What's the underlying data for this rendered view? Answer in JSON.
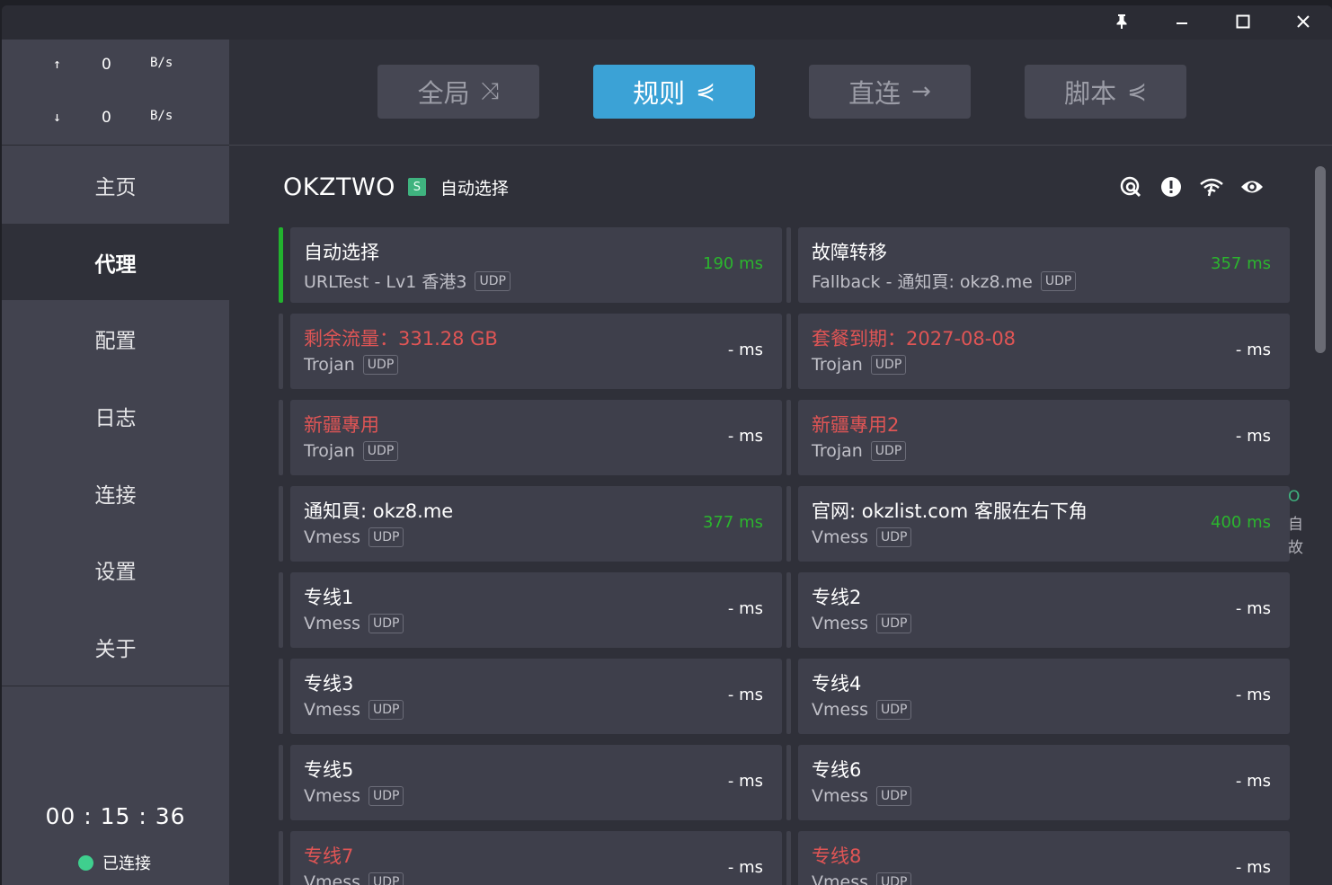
{
  "window": {
    "buttons": [
      "pin-icon",
      "minimize-icon",
      "maximize-icon",
      "close-icon"
    ]
  },
  "traffic": {
    "up_arrow": "↑",
    "up_value": "0",
    "up_unit": "B/s",
    "down_arrow": "↓",
    "down_value": "0",
    "down_unit": "B/s"
  },
  "sidebar": {
    "items": [
      {
        "label": "主页"
      },
      {
        "label": "代理"
      },
      {
        "label": "配置"
      },
      {
        "label": "日志"
      },
      {
        "label": "连接"
      },
      {
        "label": "设置"
      },
      {
        "label": "关于"
      }
    ],
    "active_index": 1,
    "timer": "00 : 15 : 36",
    "status": "已连接",
    "status_color": "#3fcf8e"
  },
  "modes": [
    {
      "label": "全局",
      "glyph": "⤨",
      "active": false
    },
    {
      "label": "规则",
      "glyph": "⋞",
      "active": true
    },
    {
      "label": "直连",
      "glyph": "→",
      "active": false
    },
    {
      "label": "脚本",
      "glyph": "⋞",
      "active": false
    }
  ],
  "group": {
    "name": "OKZTWO",
    "badge": "S",
    "selected": "自动选择",
    "icons": [
      "speed-test-icon",
      "alert-icon",
      "wifi-icon",
      "eye-icon"
    ]
  },
  "proxies": [
    {
      "name": "自动选择",
      "type": "URLTest - Lv1 香港3",
      "udp": "UDP",
      "delay": "190 ms",
      "delay_color": "green",
      "name_red": false,
      "selected": true
    },
    {
      "name": "故障转移",
      "type": "Fallback - 通知頁: okz8.me",
      "udp": "UDP",
      "delay": "357 ms",
      "delay_color": "green",
      "name_red": false,
      "selected": false
    },
    {
      "name": "剩余流量：331.28 GB",
      "type": "Trojan",
      "udp": "UDP",
      "delay": "- ms",
      "delay_color": "white",
      "name_red": true,
      "selected": false
    },
    {
      "name": "套餐到期：2027-08-08",
      "type": "Trojan",
      "udp": "UDP",
      "delay": "- ms",
      "delay_color": "white",
      "name_red": true,
      "selected": false
    },
    {
      "name": "新疆專用",
      "type": "Trojan",
      "udp": "UDP",
      "delay": "- ms",
      "delay_color": "white",
      "name_red": true,
      "selected": false
    },
    {
      "name": "新疆專用2",
      "type": "Trojan",
      "udp": "UDP",
      "delay": "- ms",
      "delay_color": "white",
      "name_red": true,
      "selected": false
    },
    {
      "name": "通知頁: okz8.me",
      "type": "Vmess",
      "udp": "UDP",
      "delay": "377 ms",
      "delay_color": "green",
      "name_red": false,
      "selected": false
    },
    {
      "name": "官网: okzlist.com 客服在右下角",
      "type": "Vmess",
      "udp": "UDP",
      "delay": "400 ms",
      "delay_color": "green",
      "name_red": false,
      "selected": false
    },
    {
      "name": "专线1",
      "type": "Vmess",
      "udp": "UDP",
      "delay": "- ms",
      "delay_color": "white",
      "name_red": false,
      "selected": false
    },
    {
      "name": "专线2",
      "type": "Vmess",
      "udp": "UDP",
      "delay": "- ms",
      "delay_color": "white",
      "name_red": false,
      "selected": false
    },
    {
      "name": "专线3",
      "type": "Vmess",
      "udp": "UDP",
      "delay": "- ms",
      "delay_color": "white",
      "name_red": false,
      "selected": false
    },
    {
      "name": "专线4",
      "type": "Vmess",
      "udp": "UDP",
      "delay": "- ms",
      "delay_color": "white",
      "name_red": false,
      "selected": false
    },
    {
      "name": "专线5",
      "type": "Vmess",
      "udp": "UDP",
      "delay": "- ms",
      "delay_color": "white",
      "name_red": false,
      "selected": false
    },
    {
      "name": "专线6",
      "type": "Vmess",
      "udp": "UDP",
      "delay": "- ms",
      "delay_color": "white",
      "name_red": false,
      "selected": false
    },
    {
      "name": "专线7",
      "type": "Vmess",
      "udp": "UDP",
      "delay": "- ms",
      "delay_color": "white",
      "name_red": true,
      "selected": false
    },
    {
      "name": "专线8",
      "type": "Vmess",
      "udp": "UDP",
      "delay": "- ms",
      "delay_color": "white",
      "name_red": true,
      "selected": false
    }
  ],
  "side_peek": [
    "O",
    "自",
    "故"
  ]
}
